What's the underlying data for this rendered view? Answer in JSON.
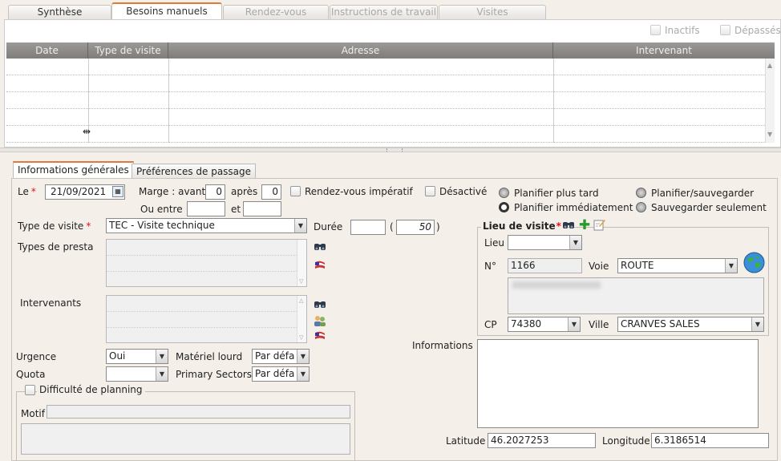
{
  "top_tabs": [
    {
      "label": "Synthèse",
      "state": "normal"
    },
    {
      "label": "Besoins manuels",
      "state": "active"
    },
    {
      "label": "Rendez-vous",
      "state": "disabled"
    },
    {
      "label": "Instructions de travail",
      "state": "disabled"
    },
    {
      "label": "Visites",
      "state": "disabled"
    }
  ],
  "filters": {
    "inactifs": "Inactifs",
    "depasses": "Dépassés"
  },
  "grid": {
    "columns": [
      "Date",
      "Type de visite",
      "Adresse",
      "Intervenant"
    ],
    "rows": []
  },
  "form_tabs": [
    "Informations générales",
    "Préférences de passage"
  ],
  "general": {
    "le_label": "Le",
    "le_value": "21/09/2021",
    "marge_label": "Marge : avant",
    "marge_avant": "0",
    "apres_label": "après",
    "marge_apres": "0",
    "ou_entre_label": "Ou entre",
    "ou_entre_from": "",
    "et_label": "et",
    "ou_entre_to": "",
    "rdv_imperatif_label": "Rendez-vous impératif",
    "desactive_label": "Désactivé",
    "type_visite_label": "Type de visite",
    "type_visite_value": "TEC - Visite technique",
    "duree_label": "Durée",
    "duree_value": "",
    "duree_paren_value": "50",
    "types_presta_label": "Types de presta",
    "intervenants_label": "Intervenants",
    "urgence_label": "Urgence",
    "urgence_value": "Oui",
    "quota_label": "Quota",
    "quota_value": "",
    "materiel_lourd_label": "Matériel lourd",
    "materiel_lourd_value": "Par défa",
    "primary_sectors_label": "Primary Sectors",
    "primary_sectors_value": "Par défa",
    "difficulte_label": "Difficulté de planning",
    "motif_label": "Motif",
    "motif_value": ""
  },
  "planning": {
    "plus_tard": "Planifier plus tard",
    "immediatement": "Planifier immédiatement",
    "sauvegarder": "Planifier/sauvegarder",
    "sauvegarder_seulement": "Sauvegarder seulement",
    "selected": "immediatement"
  },
  "lieu_visite": {
    "title": "Lieu de visite",
    "lieu_label": "Lieu",
    "lieu_value": "",
    "numero_label": "N°",
    "numero_value": "1166",
    "voie_label": "Voie",
    "voie_value": "ROUTE",
    "cp_label": "CP",
    "cp_value": "74380",
    "ville_label": "Ville",
    "ville_value": "CRANVES SALES"
  },
  "informations_label": "Informations",
  "latitude_label": "Latitude",
  "latitude_value": "46.2027253",
  "longitude_label": "Longitude",
  "longitude_value": "6.3186514",
  "icons": {
    "binoculars": "binoculars-icon",
    "flag": "flag-icon",
    "users": "users-icon",
    "add": "add-icon",
    "edit": "edit-icon",
    "globe": "globe-icon",
    "calendar": "calendar-icon"
  },
  "colors": {
    "accent": "#e07a3c",
    "required": "#d12222",
    "grid_header": "#8a8784"
  }
}
